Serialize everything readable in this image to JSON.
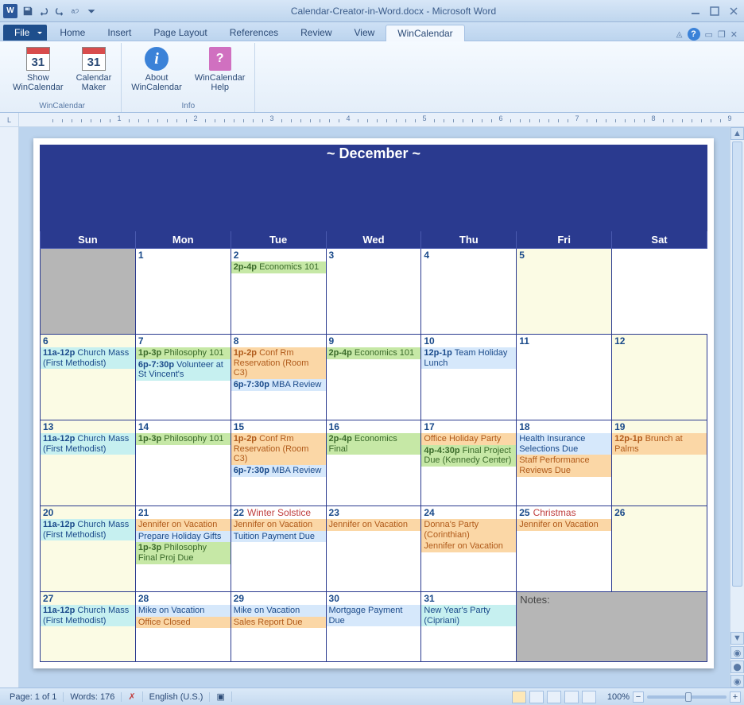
{
  "title": "Calendar-Creator-in-Word.docx - Microsoft Word",
  "tabs": {
    "file": "File",
    "home": "Home",
    "insert": "Insert",
    "page": "Page Layout",
    "ref": "References",
    "review": "Review",
    "view": "View",
    "wc": "WinCalendar"
  },
  "ribbon": {
    "group1_label": "WinCalendar",
    "show": "Show\nWinCalendar",
    "maker": "Calendar\nMaker",
    "cal_num": "31",
    "group2_label": "Info",
    "about": "About\nWinCalendar",
    "help": "WinCalendar\nHelp"
  },
  "calendar": {
    "title": "~ December ~",
    "days": [
      "Sun",
      "Mon",
      "Tue",
      "Wed",
      "Thu",
      "Fri",
      "Sat"
    ],
    "notes_label": "Notes:",
    "weeks": [
      [
        {
          "blank": true
        },
        {
          "num": "1"
        },
        {
          "num": "2",
          "ev": [
            {
              "c": "green",
              "t": "<b>2p-4p</b> Economics 101"
            }
          ]
        },
        {
          "num": "3"
        },
        {
          "num": "4"
        },
        {
          "num": "5",
          "sat": true
        }
      ],
      [
        {
          "num": "6",
          "sun": true
        },
        {
          "num": "7"
        },
        {
          "num": "8"
        },
        {
          "num": "9"
        },
        {
          "num": "10"
        },
        {
          "num": "11"
        },
        {
          "num": "12",
          "sat": true
        }
      ],
      [
        {
          "num": "13",
          "sun": true
        },
        {
          "num": "14"
        },
        {
          "num": "15"
        },
        {
          "num": "16"
        },
        {
          "num": "17"
        },
        {
          "num": "18"
        },
        {
          "num": "19",
          "sat": true
        }
      ],
      [
        {
          "num": "20",
          "sun": true
        },
        {
          "num": "21"
        },
        {
          "num": "22"
        },
        {
          "num": "23"
        },
        {
          "num": "24"
        },
        {
          "num": "25"
        },
        {
          "num": "26",
          "sat": true
        }
      ],
      [
        {
          "num": "27",
          "sun": true
        },
        {
          "num": "28"
        },
        {
          "num": "29"
        },
        {
          "num": "30"
        },
        {
          "num": "31"
        }
      ]
    ],
    "events": {
      "2": [
        {
          "c": "green",
          "t": "2p-4p",
          "d": "Economics 101"
        }
      ],
      "6": [
        {
          "c": "cyan",
          "t": "11a-12p",
          "d": "Church Mass (First Methodist)"
        }
      ],
      "7": [
        {
          "c": "green",
          "t": "1p-3p",
          "d": "Philosophy 101"
        },
        {
          "c": "cyan",
          "t": "6p-7:30p",
          "d": "Volunteer at St Vincent's"
        }
      ],
      "8": [
        {
          "c": "orange",
          "t": "1p-2p",
          "d": "Conf Rm Reservation (Room C3)"
        },
        {
          "c": "lblue",
          "t": "6p-7:30p",
          "d": "MBA Review"
        }
      ],
      "9": [
        {
          "c": "green",
          "t": "2p-4p",
          "d": "Economics 101"
        }
      ],
      "10": [
        {
          "c": "lblue",
          "t": "12p-1p",
          "d": "Team Holiday Lunch"
        }
      ],
      "13": [
        {
          "c": "cyan",
          "t": "11a-12p",
          "d": "Church Mass (First Methodist)"
        }
      ],
      "14": [
        {
          "c": "green",
          "t": "1p-3p",
          "d": "Philosophy 101"
        }
      ],
      "15": [
        {
          "c": "orange",
          "t": "1p-2p",
          "d": "Conf Rm Reservation (Room C3)"
        },
        {
          "c": "lblue",
          "t": "6p-7:30p",
          "d": "MBA Review"
        }
      ],
      "16": [
        {
          "c": "green",
          "t": "2p-4p",
          "d": "Economics Final"
        }
      ],
      "17": [
        {
          "c": "orange",
          "t": "",
          "d": "Office Holiday Party"
        },
        {
          "c": "green",
          "t": "4p-4:30p",
          "d": "Final Project Due (Kennedy Center)"
        }
      ],
      "18": [
        {
          "c": "lblue",
          "t": "",
          "d": "Health Insurance Selections Due"
        },
        {
          "c": "orange",
          "t": "",
          "d": "Staff Performance Reviews Due"
        }
      ],
      "19": [
        {
          "c": "orange",
          "t": "12p-1p",
          "d": "Brunch at Palms"
        }
      ],
      "20": [
        {
          "c": "cyan",
          "t": "11a-12p",
          "d": "Church Mass (First Methodist)"
        }
      ],
      "21": [
        {
          "c": "orange",
          "t": "",
          "d": "Jennifer on Vacation"
        },
        {
          "c": "lblue",
          "t": "",
          "d": "Prepare Holiday Gifts"
        },
        {
          "c": "green",
          "t": "1p-3p",
          "d": "Philosophy Final Proj Due"
        }
      ],
      "22": [
        {
          "c": "holiday",
          "t": "",
          "d": "Winter Solstice",
          "hdr": true
        },
        {
          "c": "orange",
          "t": "",
          "d": "Jennifer on Vacation"
        },
        {
          "c": "lblue",
          "t": "",
          "d": "Tuition Payment Due"
        }
      ],
      "23": [
        {
          "c": "orange",
          "t": "",
          "d": "Jennifer on Vacation"
        }
      ],
      "24": [
        {
          "c": "orange",
          "t": "",
          "d": "Donna's Party (Corinthian)"
        },
        {
          "c": "orange",
          "t": "",
          "d": "Jennifer on Vacation"
        }
      ],
      "25": [
        {
          "c": "holiday",
          "t": "",
          "d": "Christmas",
          "hdr": true
        },
        {
          "c": "orange",
          "t": "",
          "d": "Jennifer on Vacation"
        }
      ],
      "27": [
        {
          "c": "cyan",
          "t": "11a-12p",
          "d": "Church Mass (First Methodist)"
        }
      ],
      "28": [
        {
          "c": "lblue",
          "t": "",
          "d": "Mike on Vacation"
        },
        {
          "c": "orange",
          "t": "",
          "d": "Office Closed"
        }
      ],
      "29": [
        {
          "c": "lblue",
          "t": "",
          "d": "Mike on Vacation"
        },
        {
          "c": "orange",
          "t": "",
          "d": "Sales Report Due"
        }
      ],
      "30": [
        {
          "c": "lblue",
          "t": "",
          "d": "Mortgage Payment Due"
        }
      ],
      "31": [
        {
          "c": "cyan",
          "t": "",
          "d": "New Year's Party (Cipriani)"
        }
      ]
    }
  },
  "status": {
    "page": "Page: 1 of 1",
    "words": "Words: 176",
    "lang": "English (U.S.)",
    "zoom": "100%"
  }
}
